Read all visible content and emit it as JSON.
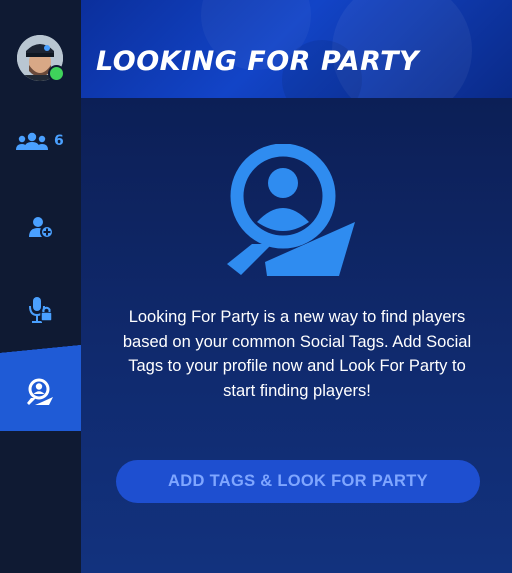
{
  "header": {
    "title": "LOOKING FOR PARTY"
  },
  "sidebar": {
    "user": {
      "status": "online",
      "status_color": "#3fd35b"
    },
    "items": [
      {
        "id": "friends",
        "icon": "friends-icon",
        "count": "6",
        "active": false
      },
      {
        "id": "add-friend",
        "icon": "add-friend-icon",
        "active": false
      },
      {
        "id": "voice-chat-lock",
        "icon": "microphone-lock-icon",
        "active": false
      },
      {
        "id": "looking-for-party",
        "icon": "looking-for-party-icon",
        "active": true
      }
    ],
    "active_color": "#1f5bd6"
  },
  "main": {
    "icon": "looking-for-party-icon",
    "description": "Looking For Party is a new way to find players based on your common Social Tags. Add Social Tags to your profile now and Look For Party to start finding players!",
    "cta_label": "ADD TAGS & LOOK FOR PARTY"
  },
  "colors": {
    "accent": "#2f8cf0",
    "button_bg": "#1e4fd0",
    "button_text": "#7fa6ff"
  }
}
